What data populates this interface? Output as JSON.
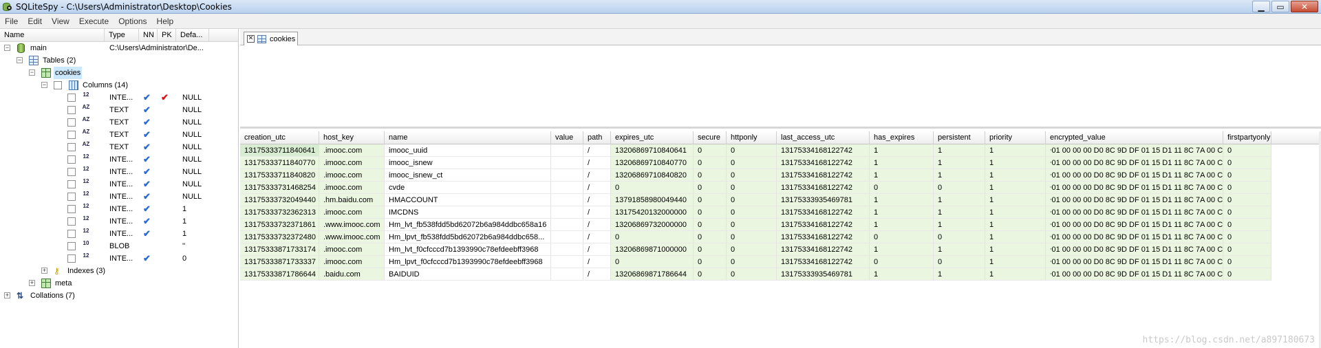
{
  "window": {
    "title": "SQLiteSpy - C:\\Users\\Administrator\\Desktop\\Cookies",
    "minimize": "▁",
    "maximize": "▭",
    "close": "✕"
  },
  "menu": [
    "File",
    "Edit",
    "View",
    "Execute",
    "Options",
    "Help"
  ],
  "tree": {
    "headers": [
      "Name",
      "Type",
      "NN",
      "PK",
      "Defa..."
    ],
    "main_label": "main",
    "main_path": "C:\\Users\\Administrator\\De...",
    "tables_label": "Tables (2)",
    "cookies_label": "cookies",
    "columns_label": "Columns (14)",
    "columns": [
      {
        "type": "INTE...",
        "nn": "✔",
        "pk": "✔",
        "def": "NULL",
        "icon": "12"
      },
      {
        "type": "TEXT",
        "nn": "✔",
        "pk": "",
        "def": "NULL",
        "icon": "AZ"
      },
      {
        "type": "TEXT",
        "nn": "✔",
        "pk": "",
        "def": "NULL",
        "icon": "AZ"
      },
      {
        "type": "TEXT",
        "nn": "✔",
        "pk": "",
        "def": "NULL",
        "icon": "AZ"
      },
      {
        "type": "TEXT",
        "nn": "✔",
        "pk": "",
        "def": "NULL",
        "icon": "AZ"
      },
      {
        "type": "INTE...",
        "nn": "✔",
        "pk": "",
        "def": "NULL",
        "icon": "12"
      },
      {
        "type": "INTE...",
        "nn": "✔",
        "pk": "",
        "def": "NULL",
        "icon": "12"
      },
      {
        "type": "INTE...",
        "nn": "✔",
        "pk": "",
        "def": "NULL",
        "icon": "12"
      },
      {
        "type": "INTE...",
        "nn": "✔",
        "pk": "",
        "def": "NULL",
        "icon": "12"
      },
      {
        "type": "INTE...",
        "nn": "✔",
        "pk": "",
        "def": "1",
        "icon": "12"
      },
      {
        "type": "INTE...",
        "nn": "✔",
        "pk": "",
        "def": "1",
        "icon": "12"
      },
      {
        "type": "INTE...",
        "nn": "✔",
        "pk": "",
        "def": "1",
        "icon": "12"
      },
      {
        "type": "BLOB",
        "nn": "",
        "pk": "",
        "def": "''",
        "icon": "10"
      },
      {
        "type": "INTE...",
        "nn": "✔",
        "pk": "",
        "def": "0",
        "icon": "12"
      }
    ],
    "indexes_label": "Indexes (3)",
    "meta_label": "meta",
    "collations_label": "Collations (7)"
  },
  "tab": {
    "label": "cookies"
  },
  "grid": {
    "columns": [
      "creation_utc",
      "host_key",
      "name",
      "value",
      "path",
      "expires_utc",
      "secure",
      "httponly",
      "last_access_utc",
      "has_expires",
      "persistent",
      "priority",
      "encrypted_value",
      "firstpartyonly"
    ],
    "rows": [
      [
        "13175333711840641",
        ".imooc.com",
        "imooc_uuid",
        "",
        "/",
        "13206869710840641",
        "0",
        "0",
        "13175334168122742",
        "1",
        "1",
        "1",
        "01 00 00 00 D0 8C 9D DF 01 15 D1 11 8C 7A 00 C0",
        "0"
      ],
      [
        "13175333711840770",
        ".imooc.com",
        "imooc_isnew",
        "",
        "/",
        "13206869710840770",
        "0",
        "0",
        "13175334168122742",
        "1",
        "1",
        "1",
        "01 00 00 00 D0 8C 9D DF 01 15 D1 11 8C 7A 00 C0",
        "0"
      ],
      [
        "13175333711840820",
        ".imooc.com",
        "imooc_isnew_ct",
        "",
        "/",
        "13206869710840820",
        "0",
        "0",
        "13175334168122742",
        "1",
        "1",
        "1",
        "01 00 00 00 D0 8C 9D DF 01 15 D1 11 8C 7A 00 C0",
        "0"
      ],
      [
        "13175333731468254",
        ".imooc.com",
        "cvde",
        "",
        "/",
        "0",
        "0",
        "0",
        "13175334168122742",
        "0",
        "0",
        "1",
        "01 00 00 00 D0 8C 9D DF 01 15 D1 11 8C 7A 00 C0",
        "0"
      ],
      [
        "13175333732049440",
        ".hm.baidu.com",
        "HMACCOUNT",
        "",
        "/",
        "13791858980049440",
        "0",
        "0",
        "13175333935469781",
        "1",
        "1",
        "1",
        "01 00 00 00 D0 8C 9D DF 01 15 D1 11 8C 7A 00 C0",
        "0"
      ],
      [
        "13175333732362313",
        ".imooc.com",
        "IMCDNS",
        "",
        "/",
        "13175420132000000",
        "0",
        "0",
        "13175334168122742",
        "1",
        "1",
        "1",
        "01 00 00 00 D0 8C 9D DF 01 15 D1 11 8C 7A 00 C0",
        "0"
      ],
      [
        "13175333732371861",
        ".www.imooc.com",
        "Hm_lvt_fb538fdd5bd62072b6a984ddbc658a16",
        "",
        "/",
        "13206869732000000",
        "0",
        "0",
        "13175334168122742",
        "1",
        "1",
        "1",
        "01 00 00 00 D0 8C 9D DF 01 15 D1 11 8C 7A 00 C0",
        "0"
      ],
      [
        "13175333732372480",
        ".www.imooc.com",
        "Hm_lpvt_fb538fdd5bd62072b6a984ddbc658...",
        "",
        "/",
        "0",
        "0",
        "0",
        "13175334168122742",
        "0",
        "0",
        "1",
        "01 00 00 00 D0 8C 9D DF 01 15 D1 11 8C 7A 00 C0",
        "0"
      ],
      [
        "13175333871733174",
        ".imooc.com",
        "Hm_lvt_f0cfcccd7b1393990c78efdeebff3968",
        "",
        "/",
        "13206869871000000",
        "0",
        "0",
        "13175334168122742",
        "1",
        "1",
        "1",
        "01 00 00 00 D0 8C 9D DF 01 15 D1 11 8C 7A 00 C0",
        "0"
      ],
      [
        "13175333871733337",
        ".imooc.com",
        "Hm_lpvt_f0cfcccd7b1393990c78efdeebff3968",
        "",
        "/",
        "0",
        "0",
        "0",
        "13175334168122742",
        "0",
        "0",
        "1",
        "01 00 00 00 D0 8C 9D DF 01 15 D1 11 8C 7A 00 C0",
        "0"
      ],
      [
        "13175333871786644",
        ".baidu.com",
        "BAIDUID",
        "",
        "/",
        "13206869871786644",
        "0",
        "0",
        "13175333935469781",
        "1",
        "1",
        "1",
        "01 00 00 00 D0 8C 9D DF 01 15 D1 11 8C 7A 00 C0",
        "0"
      ]
    ]
  },
  "watermark": "https://blog.csdn.net/a897180673",
  "colors": {
    "row_tint": "#eaf6e0",
    "selected_row": "#d7ecd0",
    "nn_check": "#2a6ad1",
    "pk_check": "#dd1111"
  }
}
